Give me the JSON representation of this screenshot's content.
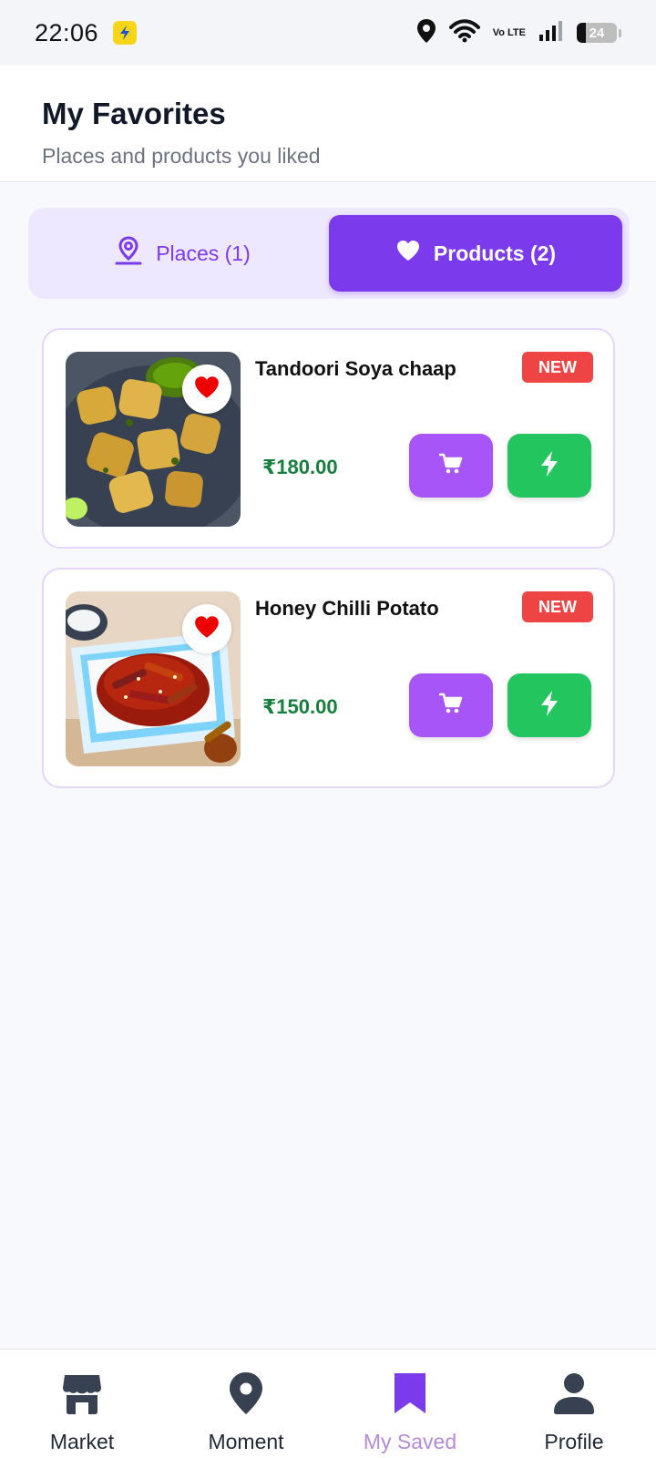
{
  "status_bar": {
    "time": "22:06",
    "network": "Vo LTE",
    "battery": "24",
    "icons": [
      "flash-icon",
      "location-icon",
      "wifi-icon",
      "signal-icon",
      "battery-icon"
    ]
  },
  "header": {
    "title": "My Favorites",
    "subtitle": "Places and products you liked"
  },
  "tabs": [
    {
      "label": "Places (1)",
      "icon": "map-pin-icon",
      "active": false
    },
    {
      "label": "Products (2)",
      "icon": "heart-icon",
      "active": true
    }
  ],
  "products": [
    {
      "name": "Tandoori Soya chaap",
      "badge": "NEW",
      "price": "₹180.00",
      "favorited": true
    },
    {
      "name": "Honey Chilli Potato",
      "badge": "NEW",
      "price": "₹150.00",
      "favorited": true
    }
  ],
  "bottom_nav": [
    {
      "label": "Market",
      "icon": "store-icon",
      "active": false
    },
    {
      "label": "Moment",
      "icon": "location-pin-icon",
      "active": false
    },
    {
      "label": "My Saved",
      "icon": "bookmark-icon",
      "active": true
    },
    {
      "label": "Profile",
      "icon": "user-icon",
      "active": false
    }
  ],
  "colors": {
    "accent": "#7c3aed",
    "tab_bg": "#ede7ff",
    "cart_button": "#a855f7",
    "buy_button": "#22c55e",
    "price": "#15803d",
    "badge": "#ef4444",
    "active_nav": "#b58bd8"
  }
}
